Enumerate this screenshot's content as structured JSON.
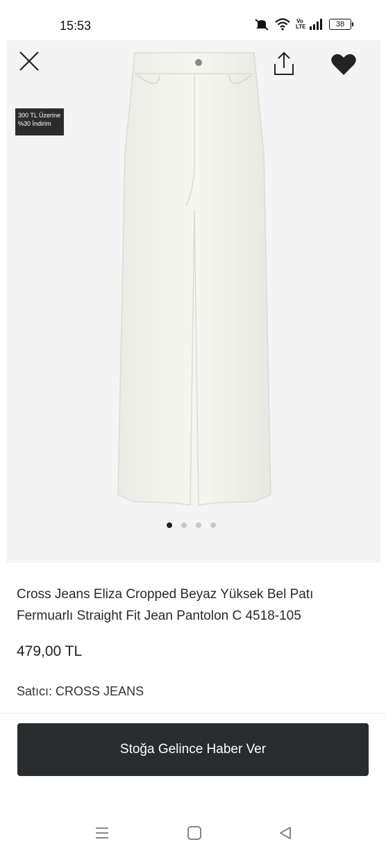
{
  "status_bar": {
    "time": "15:53",
    "network_label": "Vo LTE",
    "battery": "38",
    "icons": [
      "mute-icon",
      "wifi-icon",
      "volte-icon",
      "signal-icon",
      "battery-icon"
    ]
  },
  "header": {
    "icons": [
      "close-icon",
      "share-icon",
      "heart-icon"
    ],
    "favorite_color": "#222222"
  },
  "promo_badge": {
    "line1": "300 TL Üzerine",
    "line2": "%30 İndirim"
  },
  "gallery": {
    "image_count": 4,
    "active_index": 0,
    "background": "#f4f4f4",
    "product_color": "#f3f3ee"
  },
  "product": {
    "title": "Cross Jeans Eliza Cropped Beyaz Yüksek Bel Patı Fermuarlı Straight Fit Jean Pantolon C 4518-105",
    "price": "479,00 TL",
    "seller_label": "Satıcı:",
    "seller_name": "CROSS JEANS"
  },
  "cta": {
    "label": "Stoğa Gelince Haber Ver",
    "background": "#2a2b2d"
  },
  "nav_bar": {
    "icons": [
      "menu-icon",
      "home-icon",
      "back-icon"
    ]
  }
}
